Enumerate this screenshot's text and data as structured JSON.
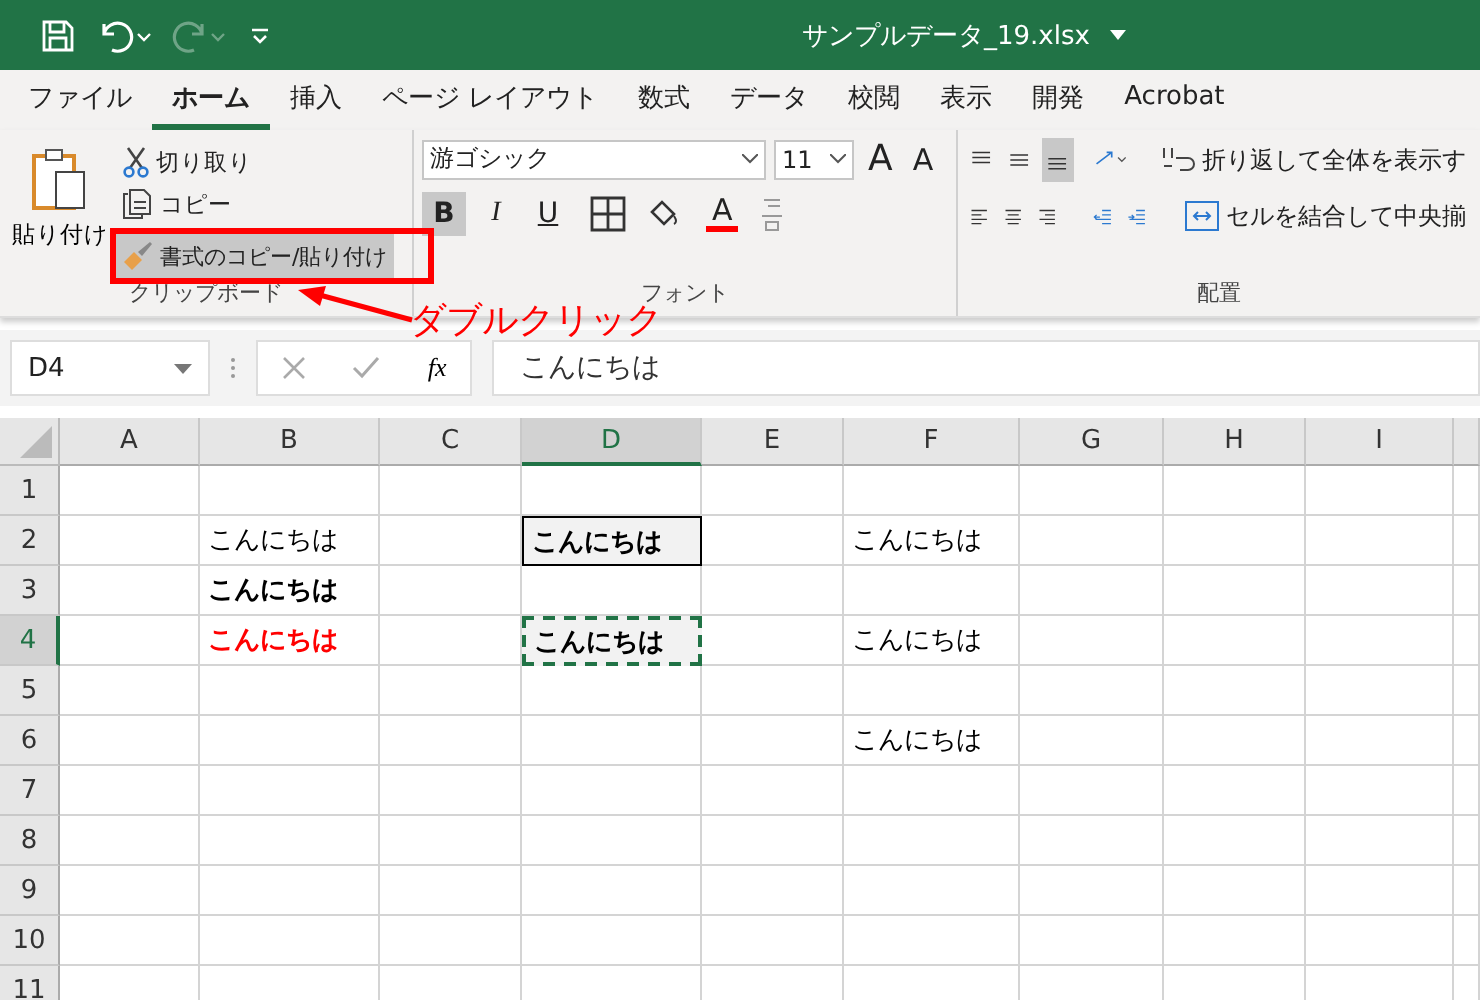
{
  "title_bar": {
    "filename": "サンプルデータ_19.xlsx"
  },
  "ribbon_tabs": [
    {
      "label": "ファイル",
      "selected": false
    },
    {
      "label": "ホーム",
      "selected": true
    },
    {
      "label": "挿入",
      "selected": false
    },
    {
      "label": "ページ レイアウト",
      "selected": false
    },
    {
      "label": "数式",
      "selected": false
    },
    {
      "label": "データ",
      "selected": false
    },
    {
      "label": "校閲",
      "selected": false
    },
    {
      "label": "表示",
      "selected": false
    },
    {
      "label": "開発",
      "selected": false
    },
    {
      "label": "Acrobat",
      "selected": false
    }
  ],
  "clipboard_group": {
    "label": "クリップボード",
    "paste": "貼り付け",
    "cut": "切り取り",
    "copy": "コピー",
    "format_painter": "書式のコピー/貼り付け"
  },
  "font_group": {
    "label": "フォント",
    "font_name": "游ゴシック",
    "font_size": "11",
    "grow": "A",
    "shrink": "A",
    "font_color": "A",
    "style_buttons": [
      {
        "kind": "bold",
        "label": "B",
        "pressed": true
      },
      {
        "kind": "italic",
        "label": "I",
        "pressed": false
      },
      {
        "kind": "underline",
        "label": "U",
        "pressed": false
      }
    ]
  },
  "alignment_group": {
    "label": "配置",
    "wrap_text": "折り返して全体を表示す",
    "merge": "セルを結合して中央揃",
    "vertical_buttons": [
      {
        "kind": "top",
        "pressed": false
      },
      {
        "kind": "middle",
        "pressed": false
      },
      {
        "kind": "bottom",
        "pressed": true
      }
    ]
  },
  "annotation": {
    "text": "ダブルクリック"
  },
  "formula_bar": {
    "name_box": "D4",
    "fx": "fx",
    "formula": "こんにちは"
  },
  "columns": [
    {
      "label": "A",
      "selected": false
    },
    {
      "label": "B",
      "selected": false
    },
    {
      "label": "C",
      "selected": false
    },
    {
      "label": "D",
      "selected": true
    },
    {
      "label": "E",
      "selected": false
    },
    {
      "label": "F",
      "selected": false
    },
    {
      "label": "G",
      "selected": false
    },
    {
      "label": "H",
      "selected": false
    },
    {
      "label": "I",
      "selected": false
    }
  ],
  "rows": [
    {
      "header": "1",
      "selected": false
    },
    {
      "header": "2",
      "selected": false,
      "cells": {
        "B": {
          "kind": "plain",
          "text": "こんにちは",
          "bold": false,
          "color": "#000000",
          "shaded": false
        },
        "D": {
          "kind": "boxed",
          "text": "こんにちは",
          "bold": true,
          "color": "#000000",
          "shaded": true
        },
        "F": {
          "kind": "plain",
          "text": "こんにちは",
          "bold": false,
          "color": "#000000",
          "shaded": false
        }
      }
    },
    {
      "header": "3",
      "selected": false,
      "cells": {
        "B": {
          "kind": "plain",
          "text": "こんにちは",
          "bold": true,
          "color": "#000000",
          "shaded": false
        }
      }
    },
    {
      "header": "4",
      "selected": true,
      "cells": {
        "B": {
          "kind": "plain",
          "text": "こんにちは",
          "bold": true,
          "color": "#ff0000",
          "shaded": false
        },
        "D": {
          "kind": "marquee",
          "text": "こんにちは",
          "bold": true,
          "color": "#000000",
          "shaded": true
        },
        "F": {
          "kind": "plain",
          "text": "こんにちは",
          "bold": false,
          "color": "#000000",
          "shaded": false
        }
      }
    },
    {
      "header": "5",
      "selected": false
    },
    {
      "header": "6",
      "selected": false,
      "cells": {
        "F": {
          "kind": "plain",
          "text": "こんにちは",
          "bold": false,
          "color": "#000000",
          "shaded": false
        }
      }
    },
    {
      "header": "7",
      "selected": false
    },
    {
      "header": "8",
      "selected": false
    },
    {
      "header": "9",
      "selected": false
    },
    {
      "header": "10",
      "selected": false
    },
    {
      "header": "11",
      "selected": false
    }
  ]
}
